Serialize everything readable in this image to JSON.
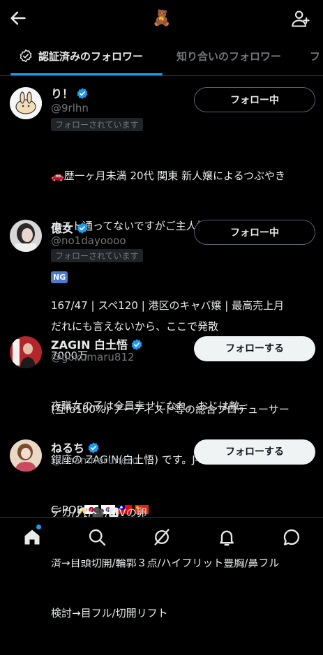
{
  "header": {
    "title_icon": "🧸",
    "back_icon": "back-arrow-icon",
    "add_icon": "add-user-icon"
  },
  "tabs": [
    {
      "label": "認証済みのフォロワー"
    },
    {
      "label": "知り合いのフォロワー"
    },
    {
      "label": "フ"
    }
  ],
  "follows_you_label": "フォローされています",
  "users": [
    {
      "name": "り！",
      "handle": "@9rlhn",
      "button": "フォロー中",
      "bio_1": "🚗歴一ヶ月未満 20代 関東 新人嬢によるつぶやき",
      "bio_2": "ホスト通ってないですがご主人様に貢いでます。男",
      "bio_ng": "NG",
      "bio_3": "だれにも言えないから、ここで発散"
    },
    {
      "name": "億女",
      "handle": "@no1dayoooo",
      "button": "フォロー中",
      "bio_1": "167/47 | スペ120 | 港区のキャバ嬢 | 最高売上月",
      "bio_2": "7000万",
      "bio_3": "夜職女の子は全員幸せになれ。おじは敵。"
    },
    {
      "name": "ZAGIN 白土悟",
      "handle": "@gokumaru812",
      "button": "フォローする",
      "bio_1": "(互fo100%) アーティスト等の総合プロデューサー",
      "bio_2": "銀座の ZAGIN(白土悟) です。J-POP・K-POP・",
      "bio_3": "C-POP"
    },
    {
      "name": "ねるち",
      "handle": "@chamneruneru",
      "button": "フォローする",
      "bio_1": "デカ/🥂/🎥/🅰Vの卵",
      "bio_2": "済→目頭切開/輪郭３点/ハイブリット豊胸/鼻フル",
      "bio_3": "検討→目フル/切開リフト"
    }
  ],
  "nav": [
    "home-icon",
    "search-icon",
    "grok-icon",
    "notifications-icon",
    "messages-icon"
  ],
  "colors": {
    "accent": "#1d9bf0",
    "background": "#000000",
    "secondary_text": "#71767b"
  }
}
